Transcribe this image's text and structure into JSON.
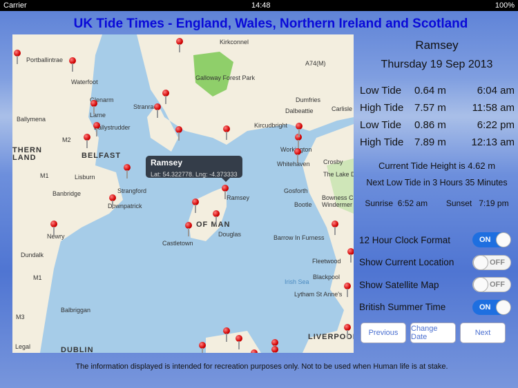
{
  "status": {
    "carrier": "Carrier",
    "time": "14:48",
    "battery": "100%"
  },
  "title": "UK Tide Times - England, Wales, Northern Ireland and Scotland",
  "map": {
    "callout": {
      "name": "Ramsey",
      "coords": "Lat: 54.322778. Lng: -4.373333"
    },
    "labels": [
      "Portballintrae",
      "Waterfoot",
      "Glenarm",
      "Larne",
      "Ballymena",
      "Ballystrudder",
      "Stranraer",
      "BELFAST",
      "Lisburn",
      "Banbridge",
      "Strangford",
      "Downpatrick",
      "Newry",
      "Dundalk",
      "Balbriggan",
      "DUBLIN",
      "Kirkconnel",
      "Galloway Forest Park",
      "Dumfries",
      "Dalbeattie",
      "Carlisle",
      "Kircudbright",
      "Workington",
      "Crosby",
      "Whitehaven",
      "The Lake D",
      "Gosforth",
      "Bowness C",
      "Bootle",
      "Windermer",
      "Ramsey",
      "Douglas",
      "Castletown",
      "Barrow In Furness",
      "Fleetwood",
      "Irish Sea",
      "Blackpool",
      "Lytham St Anne's",
      "LIVERPOOL",
      "THERN",
      "LAND",
      "OF MAN",
      "A74(M)",
      "M2",
      "M1",
      "M1",
      "M3",
      "Legal"
    ]
  },
  "location": "Ramsey",
  "date": "Thursday 19 Sep 2013",
  "tides": [
    {
      "type": "Low Tide",
      "height": "0.64 m",
      "time": "6:04 am"
    },
    {
      "type": "High Tide",
      "height": "7.57 m",
      "time": "11:58 am"
    },
    {
      "type": "Low Tide",
      "height": "0.86 m",
      "time": "6:22 pm"
    },
    {
      "type": "High Tide",
      "height": "7.89 m",
      "time": "12:13 am"
    }
  ],
  "current": "Current Tide Height is 4.62 m",
  "next": "Next Low Tide in 3 Hours 35 Minutes",
  "sunrise_label": "Sunrise",
  "sunrise": "6:52 am",
  "sunset_label": "Sunset",
  "sunset": "7:19 pm",
  "settings": [
    {
      "label": "12 Hour Clock Format",
      "state": "ON"
    },
    {
      "label": "Show Current Location",
      "state": "OFF"
    },
    {
      "label": "Show Satellite Map",
      "state": "OFF"
    },
    {
      "label": "British Summer Time",
      "state": "ON"
    }
  ],
  "buttons": {
    "previous": "Previous",
    "change_date": "Change Date",
    "next": "Next"
  },
  "footer": "The information displayed is intended for recreation purposes only. Not to be used when Human life is at stake."
}
